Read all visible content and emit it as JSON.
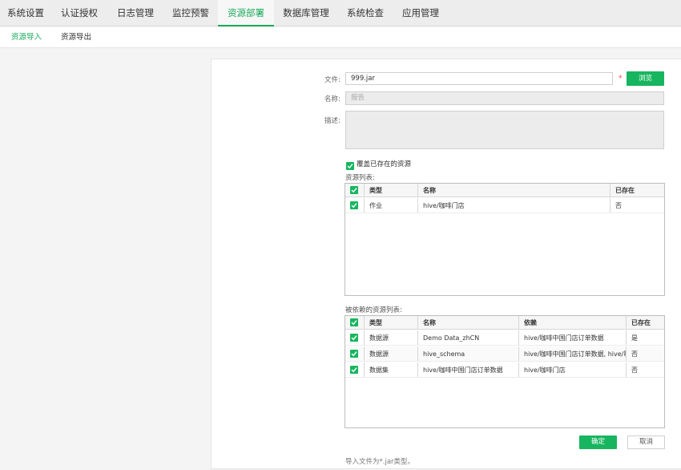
{
  "top_tabs": [
    "系统设置",
    "认证授权",
    "日志管理",
    "监控预警",
    "资源部署",
    "数据库管理",
    "系统检查",
    "应用管理"
  ],
  "active_top_tab": "资源部署",
  "sub_tabs": [
    "资源导入",
    "资源导出"
  ],
  "active_sub_tab": "资源导入",
  "form": {
    "file_label": "文件:",
    "file_value": "999.jar",
    "required_mark": "*",
    "browse_label": "浏览",
    "name_label": "名称:",
    "name_placeholder": "报告",
    "desc_label": "描述:",
    "overwrite_label": "覆盖已存在的资源",
    "overwrite_checked": true
  },
  "resource_list": {
    "title": "资源列表:",
    "columns": [
      "类型",
      "名称",
      "已存在"
    ],
    "rows": [
      {
        "type": "作业",
        "name": "hive/咖啡门店",
        "exists": "否"
      }
    ]
  },
  "dependency_list": {
    "title": "被依赖的资源列表:",
    "columns": [
      "类型",
      "名称",
      "依赖",
      "已存在"
    ],
    "rows": [
      {
        "type": "数据源",
        "name": "Demo Data_zhCN",
        "dep": "hive/咖啡中国门店订单数据",
        "exists": "是"
      },
      {
        "type": "数据源",
        "name": "hive_schema",
        "dep": "hive/咖啡中国门店订单数据, hive/咖啡门店",
        "exists": "否"
      },
      {
        "type": "数据集",
        "name": "hive/咖啡中国门店订单数据",
        "dep": "hive/咖啡门店",
        "exists": "否"
      }
    ]
  },
  "buttons": {
    "confirm": "确定",
    "cancel": "取消"
  },
  "hint": "导入文件为*.jar类型。",
  "colors": {
    "accent": "#17b55f",
    "active_text": "#17a95a"
  },
  "icons": {
    "checkbox": "check-icon"
  }
}
